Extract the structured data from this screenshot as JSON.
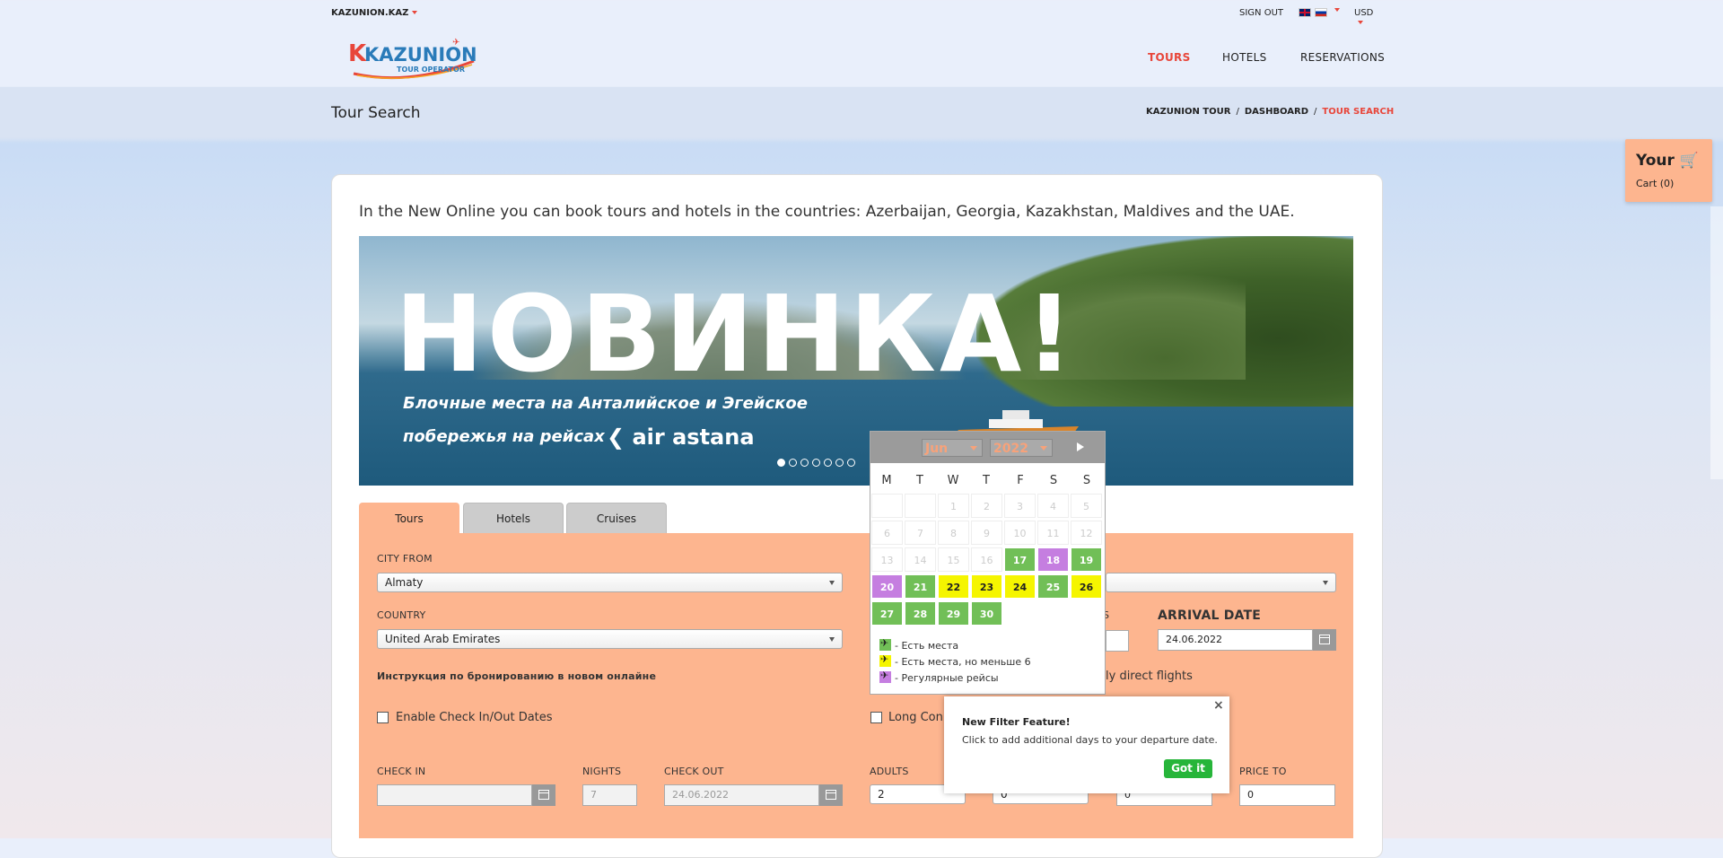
{
  "topbar": {
    "site": "KAZUNION.KAZ",
    "signout": "SIGN OUT",
    "currency": "USD"
  },
  "logo": {
    "name": "KAZUNION",
    "tag": "TOUR OPERATOR"
  },
  "nav": {
    "tours": "TOURS",
    "hotels": "HOTELS",
    "reservations": "RESERVATIONS"
  },
  "page": {
    "title": "Tour Search"
  },
  "breadcrumb": {
    "b1": "KAZUNION TOUR",
    "b2": "DASHBOARD",
    "b3": "TOUR SEARCH",
    "sep": "/"
  },
  "cart": {
    "title": "Your",
    "sub": "Cart (0)"
  },
  "intro": "In the New Online you can book tours and hotels in the countries: Azerbaijan, Georgia, Kazakhstan, Maldives and the UAE.",
  "banner": {
    "headline": "НОВИНКА!",
    "line1": "Блочные места на Анталийское и Эгейское",
    "line2": "побережья на рейсах",
    "brand": "air astana"
  },
  "tabs": {
    "tours": "Tours",
    "hotels": "Hotels",
    "cruises": "Cruises"
  },
  "form": {
    "city_from_label": "CITY FROM",
    "city_from": "Almaty",
    "country_label": "COUNTRY",
    "country": "United Arab Emirates",
    "arrival_label": "ARRIVAL DATE",
    "arrival_value": "24.06.2022",
    "nights_cut": "S",
    "instruction": "Инструкция по бронированию в новом онлайне",
    "direct_flights": "ly direct flights",
    "enable_checkin": "Enable Check In/Out Dates",
    "long_conn": "Long Conn",
    "checkin_label": "CHECK IN",
    "nights_label": "NIGHTS",
    "nights_value": "7",
    "checkout_label": "CHECK OUT",
    "checkout_value": "24.06.2022",
    "adults_label": "ADULTS",
    "adults_value": "2",
    "children_value": "0",
    "price_from_value": "0",
    "price_to_label": "PRICE TO",
    "price_to_value": "0"
  },
  "calendar": {
    "month": "Jun",
    "year": "2022",
    "weekdays": [
      "M",
      "T",
      "W",
      "T",
      "F",
      "S",
      "S"
    ],
    "grey_days": [
      "1",
      "2",
      "3",
      "4",
      "5",
      "6",
      "7",
      "8",
      "9",
      "10",
      "11",
      "12",
      "13",
      "14",
      "15",
      "16"
    ],
    "d17": "17",
    "d18": "18",
    "d19": "19",
    "d20": "20",
    "d21": "21",
    "d22": "22",
    "d23": "23",
    "d24": "24",
    "d25": "25",
    "d26": "26",
    "d27": "27",
    "d28": "28",
    "d29": "29",
    "d30": "30",
    "legend": [
      "- Есть места",
      "- Есть места, но меньше 6",
      "- Регулярные рейсы"
    ],
    "colors": {
      "available": "#71bf57",
      "few": "#f5f500",
      "regular": "#c57ee0"
    }
  },
  "popup": {
    "close": "×",
    "title": "New Filter Feature!",
    "desc": "Click to add additional days to your departure date.",
    "button": "Got it"
  }
}
